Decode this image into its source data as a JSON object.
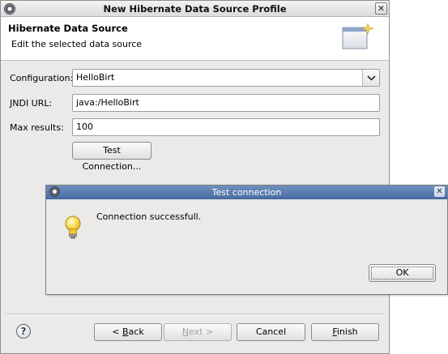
{
  "window": {
    "title": "New Hibernate Data Source Profile",
    "close_glyph": "✕"
  },
  "banner": {
    "title": "Hibernate Data Source",
    "description": "Edit the selected data source"
  },
  "form": {
    "configuration": {
      "label": "Configuration:",
      "value": "HelloBirt"
    },
    "jndi_url": {
      "label": "JNDI URL:",
      "value": "java:/HelloBirt"
    },
    "max_results": {
      "label": "Max results:",
      "value": "100"
    },
    "test_connection_label": "Test Connection..."
  },
  "footer": {
    "help_glyph": "?",
    "back_prefix": "< ",
    "back_mnemonic": "B",
    "back_rest": "ack",
    "next_mnemonic": "N",
    "next_rest": "ext >",
    "cancel_label": "Cancel",
    "finish_mnemonic": "F",
    "finish_rest": "inish"
  },
  "dialog": {
    "title": "Test connection",
    "close_glyph": "✕",
    "message": "Connection successfull.",
    "ok_label": "OK"
  },
  "colors": {
    "dialog_titlebar": "#4a6fa5",
    "window_background": "#ebeae8",
    "disabled_text": "#a3a3a1"
  },
  "icons": {
    "window": "eclipse-gear-icon",
    "banner": "wizard-window-icon",
    "dialog_message": "lightbulb-icon"
  }
}
